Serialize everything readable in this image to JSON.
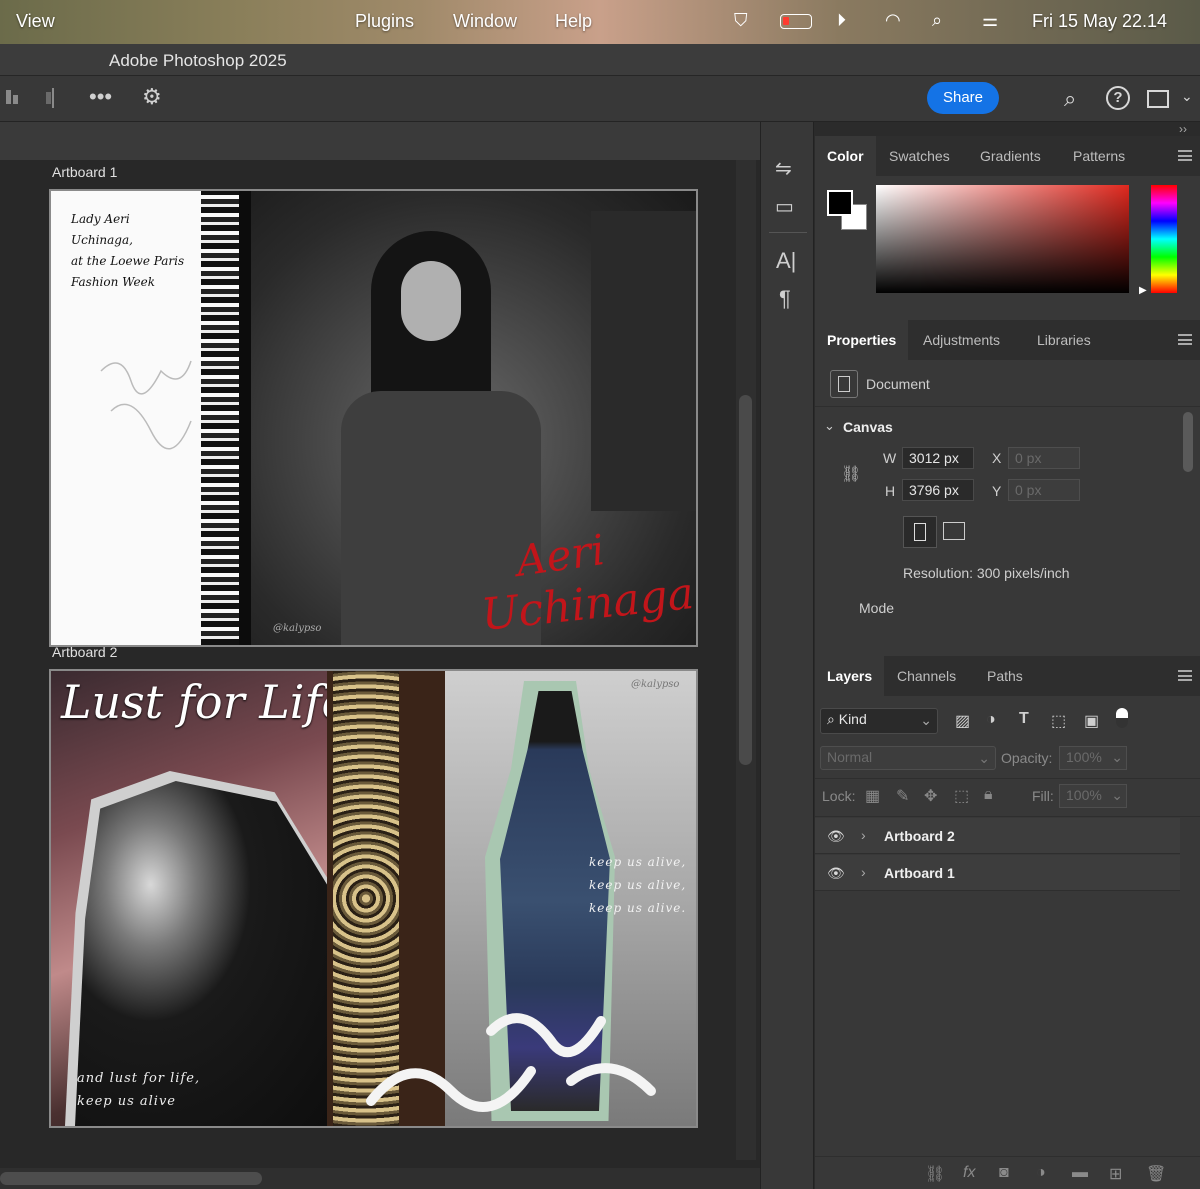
{
  "menubar": {
    "items": [
      "View",
      "Plugins",
      "Window",
      "Help"
    ],
    "datetime": "Fri 15 May  22.14"
  },
  "app": {
    "title": "Adobe Photoshop 2025",
    "share_label": "Share"
  },
  "artboards": [
    {
      "label": "Artboard 1",
      "text_left": [
        "Lady Aeri",
        "Uchinaga,",
        "at the Loewe Paris",
        "Fashion Week"
      ],
      "script_name_1": "Aeri",
      "script_name_2": "Uchinaga",
      "watermark": "@kalypso"
    },
    {
      "label": "Artboard 2",
      "title_script": "Lust for Life",
      "watermark": "@kalypso",
      "right_lines": [
        "keep us alive,",
        "keep us alive,",
        "keep us alive."
      ],
      "bottom_lines": [
        "and lust for life,",
        "keep us alive"
      ]
    }
  ],
  "color_panel": {
    "tabs": [
      "Color",
      "Swatches",
      "Gradients",
      "Patterns"
    ],
    "active_tab": "Color",
    "foreground": "#000000",
    "background": "#ffffff",
    "hue": "#e0281e"
  },
  "properties_panel": {
    "tabs": [
      "Properties",
      "Adjustments",
      "Libraries"
    ],
    "active_tab": "Properties",
    "document_label": "Document",
    "canvas_label": "Canvas",
    "w_label": "W",
    "w_value": "3012 px",
    "h_label": "H",
    "h_value": "3796 px",
    "x_label": "X",
    "x_value": "0 px",
    "y_label": "Y",
    "y_value": "0 px",
    "resolution": "Resolution: 300 pixels/inch",
    "mode_label": "Mode"
  },
  "layers_panel": {
    "tabs": [
      "Layers",
      "Channels",
      "Paths"
    ],
    "active_tab": "Layers",
    "filter_kind": "Kind",
    "blend_mode": "Normal",
    "opacity_label": "Opacity:",
    "opacity_value": "100%",
    "lock_label": "Lock:",
    "fill_label": "Fill:",
    "fill_value": "100%",
    "layers": [
      {
        "name": "Artboard 2",
        "visible": true
      },
      {
        "name": "Artboard 1",
        "visible": true
      }
    ]
  }
}
